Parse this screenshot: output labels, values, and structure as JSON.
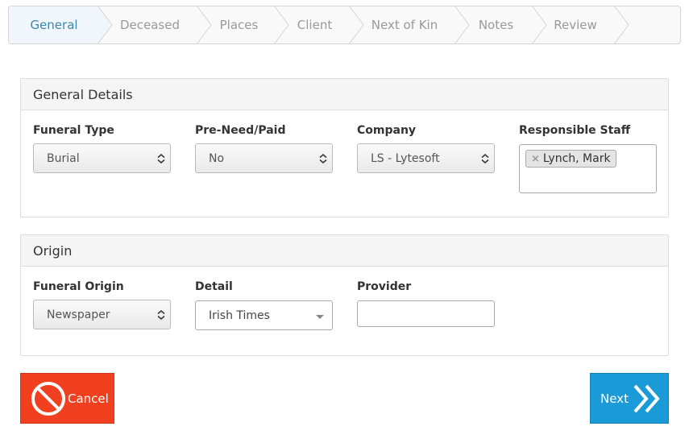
{
  "wizard": {
    "steps": [
      {
        "label": "General",
        "active": true
      },
      {
        "label": "Deceased",
        "active": false
      },
      {
        "label": "Places",
        "active": false
      },
      {
        "label": "Client",
        "active": false
      },
      {
        "label": "Next of Kin",
        "active": false
      },
      {
        "label": "Notes",
        "active": false
      },
      {
        "label": "Review",
        "active": false
      }
    ]
  },
  "general": {
    "title": "General Details",
    "funeral_type": {
      "label": "Funeral Type",
      "value": "Burial"
    },
    "pre_need": {
      "label": "Pre-Need/Paid",
      "value": "No"
    },
    "company": {
      "label": "Company",
      "value": "LS - Lytesoft"
    },
    "staff": {
      "label": "Responsible Staff",
      "tags": [
        "Lynch, Mark"
      ],
      "remove_symbol": "×"
    }
  },
  "origin": {
    "title": "Origin",
    "funeral_origin": {
      "label": "Funeral Origin",
      "value": "Newspaper"
    },
    "detail": {
      "label": "Detail",
      "value": "Irish Times"
    },
    "provider": {
      "label": "Provider",
      "value": ""
    }
  },
  "actions": {
    "cancel_label": "Cancel",
    "next_label": "Next",
    "cancel_icon": "ban-icon",
    "next_icon": "double-chevron-right-icon",
    "cancel_color": "#f0401f",
    "next_color": "#1a9ad6"
  }
}
